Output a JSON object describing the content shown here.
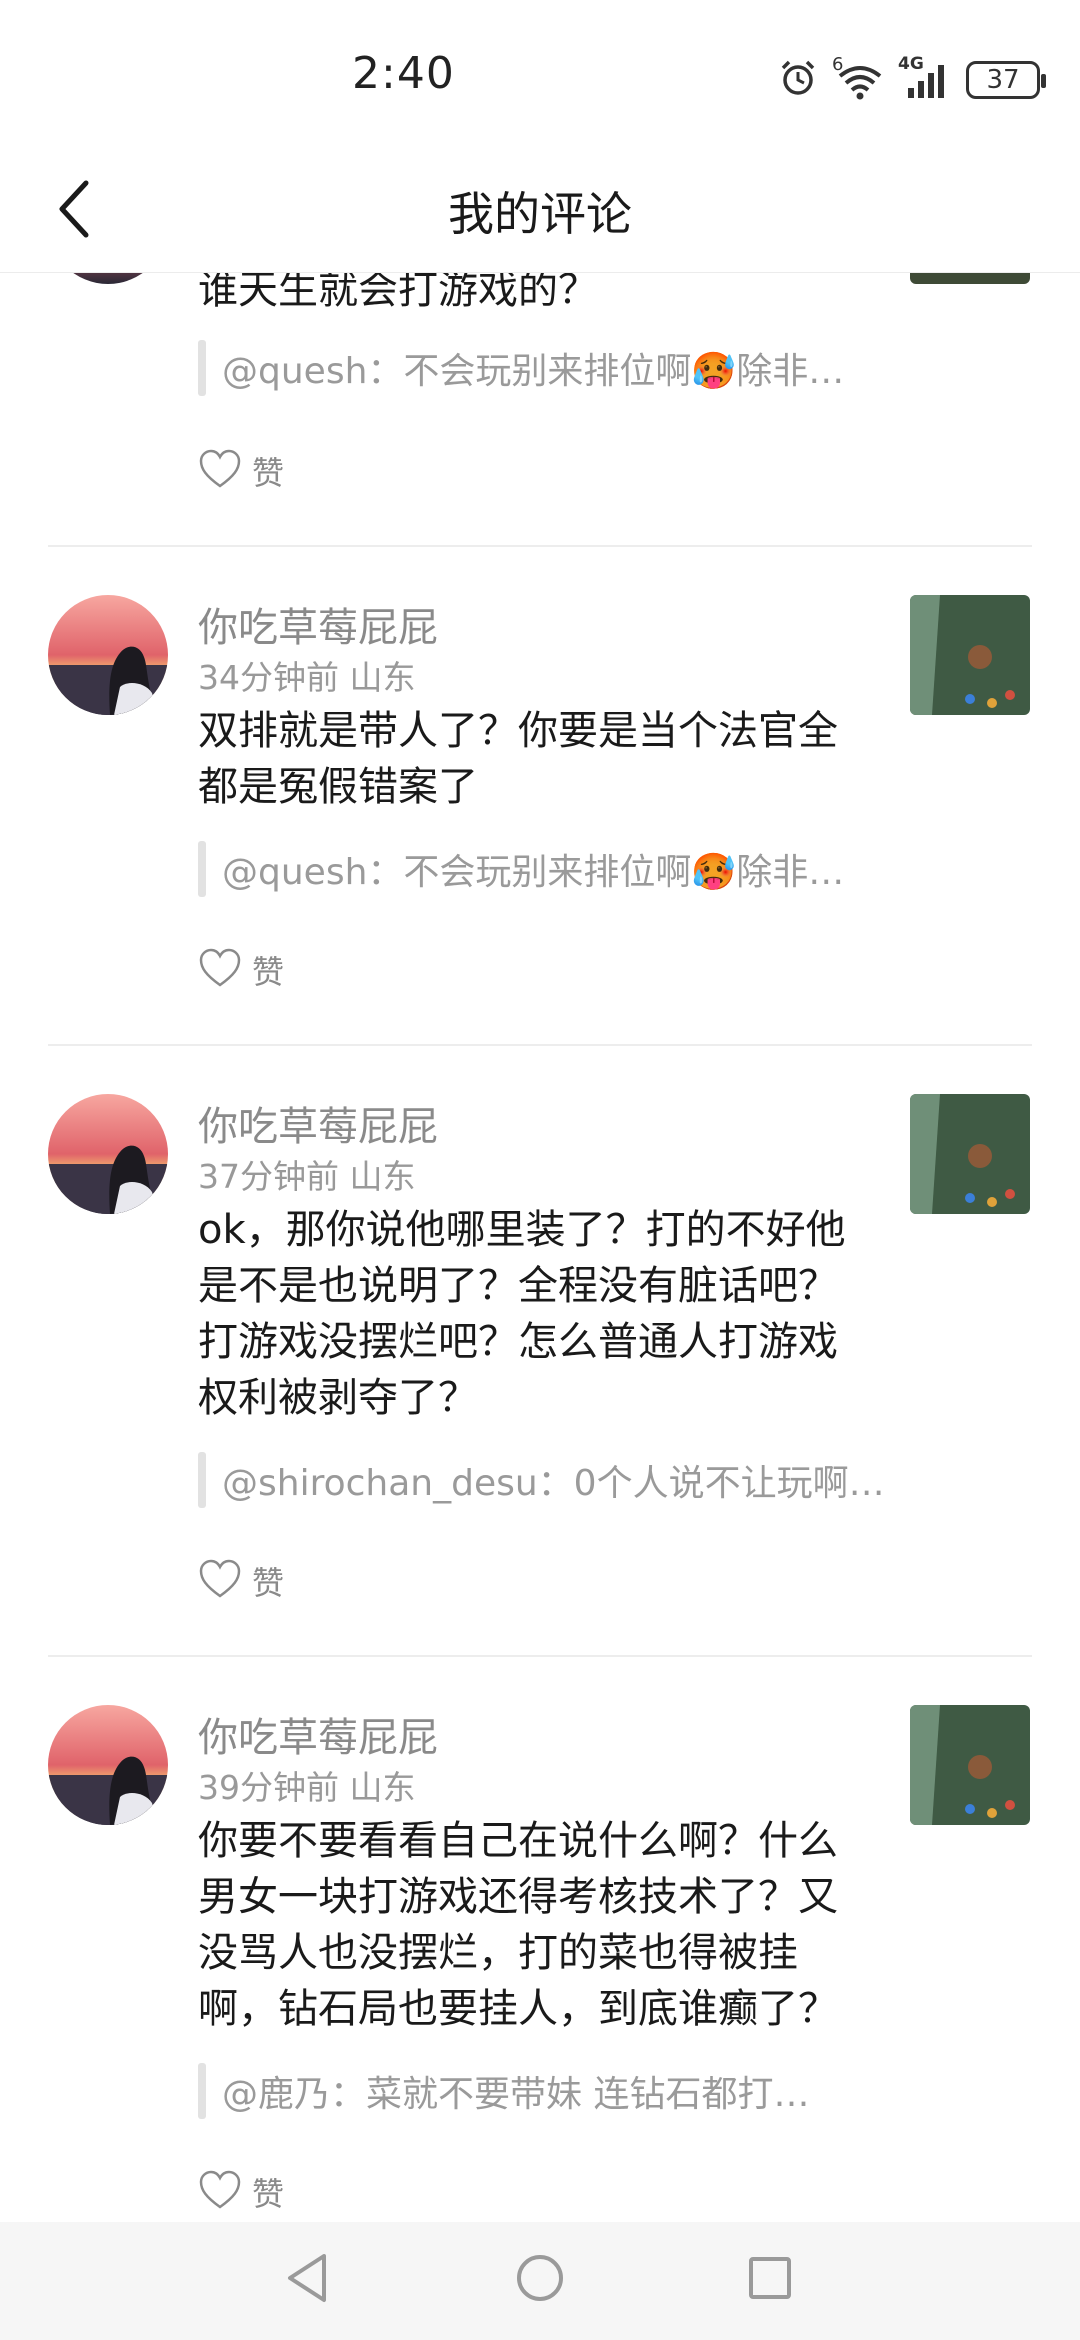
{
  "status_bar": {
    "time": "2:40",
    "battery": "37",
    "icons": [
      "alarm-icon",
      "wifi-icon",
      "signal-4g-icon",
      "battery-icon"
    ],
    "wifi_label": "6",
    "network_label": "4G"
  },
  "header": {
    "title": "我的评论",
    "back_icon": "chevron-left-icon"
  },
  "comments": [
    {
      "text": "谁天生就会打游戏的？",
      "quote": "@quesh：不会玩别来排位啊🥵除非…",
      "like_label": "赞"
    },
    {
      "username": "你吃草莓屁屁",
      "time": "34分钟前",
      "location": "山东",
      "text_lines": [
        "双排就是带人了？你要是当个法官全",
        "都是冤假错案了"
      ],
      "quote": "@quesh：不会玩别来排位啊🥵除非…",
      "like_label": "赞"
    },
    {
      "username": "你吃草莓屁屁",
      "time": "37分钟前",
      "location": "山东",
      "text_lines": [
        "ok，那你说他哪里装了？打的不好他",
        "是不是也说明了？全程没有脏话吧？",
        "打游戏没摆烂吧？怎么普通人打游戏",
        "权利被剥夺了？"
      ],
      "quote": "@shirochan_desu：0个人说不让玩啊…",
      "like_label": "赞"
    },
    {
      "username": "你吃草莓屁屁",
      "time": "39分钟前",
      "location": "山东",
      "text_lines": [
        "你要不要看看自己在说什么啊？什么",
        "男女一块打游戏还得考核技术了？又",
        "没骂人也没摆烂，打的菜也得被挂",
        "啊，钻石局也要挂人，到底谁癫了？"
      ],
      "quote": "@鹿乃：菜就不要带妹 连钻石都打…",
      "like_label": "赞"
    }
  ],
  "system_nav": {
    "icons": [
      "back-triangle-icon",
      "home-circle-icon",
      "recents-square-icon"
    ]
  },
  "colors": {
    "background": "#ffffff",
    "text_primary": "#1a1a1a",
    "text_secondary": "#8a8a8a",
    "divider": "#ededed"
  }
}
